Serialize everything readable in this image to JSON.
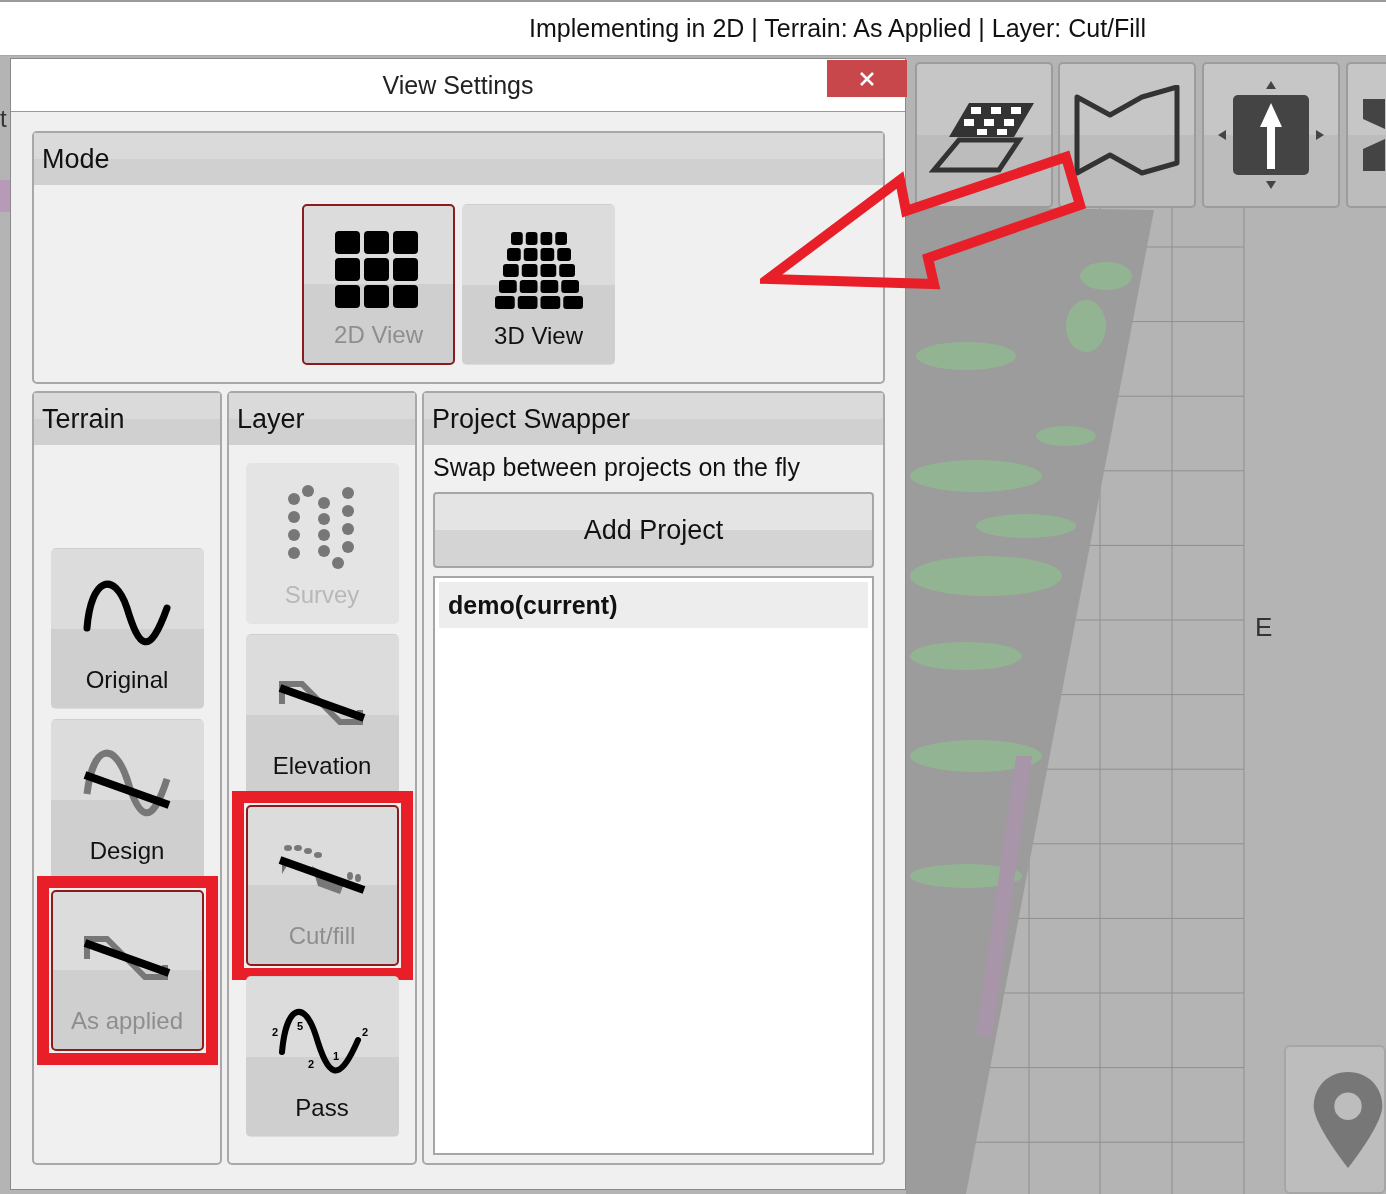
{
  "status_title": "Implementing in 2D | Terrain: As Applied | Layer: Cut/Fill",
  "left_edge_text": "t",
  "dialog": {
    "title": "View Settings",
    "mode": {
      "title": "Mode",
      "options": [
        {
          "label": "2D View",
          "kind": "grid2d",
          "selected": true
        },
        {
          "label": "3D View",
          "kind": "grid3d",
          "selected": false
        }
      ]
    },
    "terrain": {
      "title": "Terrain",
      "options": [
        {
          "label": "Original",
          "kind": "wave",
          "selected": false,
          "highlighted": false
        },
        {
          "label": "Design",
          "kind": "design",
          "selected": false,
          "highlighted": false
        },
        {
          "label": "As applied",
          "kind": "stepped",
          "selected": true,
          "highlighted": true
        }
      ]
    },
    "layer": {
      "title": "Layer",
      "options": [
        {
          "label": "Survey",
          "kind": "survey",
          "selected": false,
          "disabled": true,
          "highlighted": false
        },
        {
          "label": "Elevation",
          "kind": "stepped",
          "selected": false,
          "disabled": false,
          "highlighted": false
        },
        {
          "label": "Cut/fill",
          "kind": "cutfill",
          "selected": true,
          "disabled": false,
          "highlighted": true
        },
        {
          "label": "Pass",
          "kind": "pass",
          "selected": false,
          "disabled": false,
          "highlighted": false,
          "marks": [
            "2",
            "5",
            "2",
            "1",
            "2"
          ]
        }
      ]
    },
    "project_swapper": {
      "title": "Project Swapper",
      "description": "Swap between projects on the fly",
      "add_button": "Add Project",
      "projects": [
        {
          "name": "demo(current)",
          "selected": true
        }
      ]
    }
  },
  "map": {
    "compass_label": "E"
  }
}
